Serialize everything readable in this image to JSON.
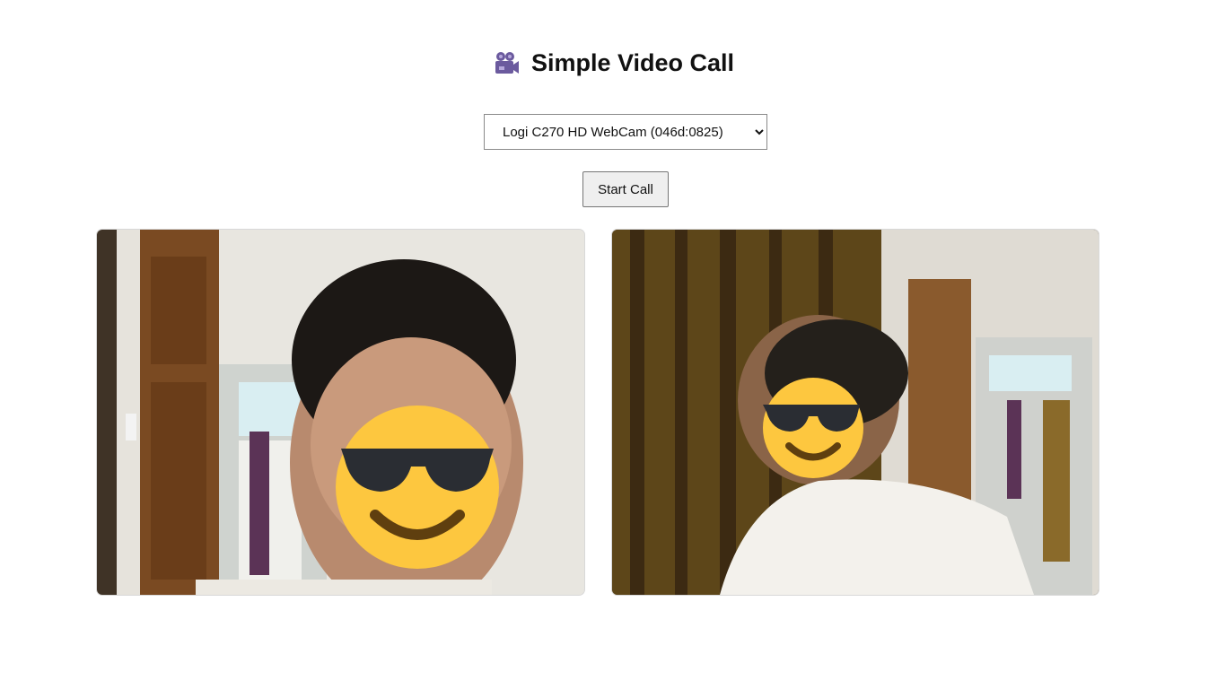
{
  "header": {
    "title": "Simple Video Call",
    "icon": "video-camera-icon",
    "icon_color": "#6b5a9e"
  },
  "camera_select": {
    "selected": "Logi C270 HD WebCam (046d:0825)",
    "options": [
      "Logi C270 HD WebCam (046d:0825)"
    ]
  },
  "controls": {
    "start_call_label": "Start Call"
  },
  "videos": {
    "local": {
      "overlay": "sunglasses-emoji-icon"
    },
    "remote": {
      "overlay": "sunglasses-emoji-icon"
    }
  },
  "colors": {
    "emoji_face": "#fdc73f",
    "emoji_glasses": "#2a2d33",
    "emoji_smile": "#5f3f0f"
  }
}
